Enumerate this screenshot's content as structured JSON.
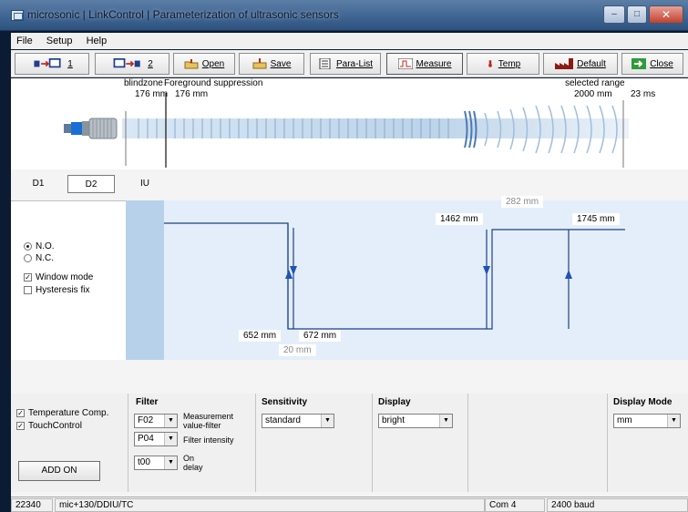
{
  "window": {
    "title": "microsonic | LinkControl | Parameterization of ultrasonic sensors",
    "minimize_glyph": "–",
    "maximize_glyph": "□",
    "close_glyph": "✕"
  },
  "menu": [
    "File",
    "Setup",
    "Help"
  ],
  "toolbar": {
    "btn1_label": "1",
    "btn2_label": "2",
    "open_label": "Open",
    "save_label": "Save",
    "paralist_label": "Para-List",
    "measure_label": "Measure",
    "temp_label": "Temp",
    "default_label": "Default",
    "close_label": "Close"
  },
  "scale": {
    "blindzone_label": "blindzone",
    "blindzone_value": "176 mm",
    "foreground_label": "Foreground suppression",
    "foreground_value": "176 mm",
    "range_label": "selected range",
    "range_value": "2000 mm",
    "response_time": "23 ms"
  },
  "tabs": {
    "d1": "D1",
    "d2": "D2",
    "iu": "IU"
  },
  "switching": {
    "no_label": "N.O.",
    "nc_label": "N.C.",
    "window_label": "Window mode",
    "hysteresis_label": "Hysteresis fix"
  },
  "diagram": {
    "p1": "652 mm",
    "p2": "672 mm",
    "hyst1": "20 mm",
    "p3": "1462 mm",
    "p4": "1745 mm",
    "hyst2": "282 mm"
  },
  "options": {
    "temp_comp": "Temperature Comp.",
    "touch_control": "TouchControl",
    "addon_label": "ADD ON"
  },
  "filter": {
    "title": "Filter",
    "filter_value": "F02",
    "filter_desc1": "Measurement",
    "filter_desc2": "value-filter",
    "intensity_value": "P04",
    "intensity_desc": "Filter intensity",
    "delay_value": "t00",
    "delay_desc1": "On",
    "delay_desc2": "delay"
  },
  "sensitivity": {
    "title": "Sensitivity",
    "value": "standard"
  },
  "display": {
    "title": "Display",
    "value": "bright"
  },
  "display_mode": {
    "title": "Display Mode",
    "value": "mm"
  },
  "status": {
    "serial": "22340",
    "model": "mic+130/DDIU/TC",
    "port": "Com 4",
    "baud": "2400 baud"
  },
  "colors": {
    "title_bar": "#3f6593",
    "diagram_bg": "#e3eefa",
    "blindzone": "#b7d1ea",
    "signal_line": "#1f3f8a"
  }
}
